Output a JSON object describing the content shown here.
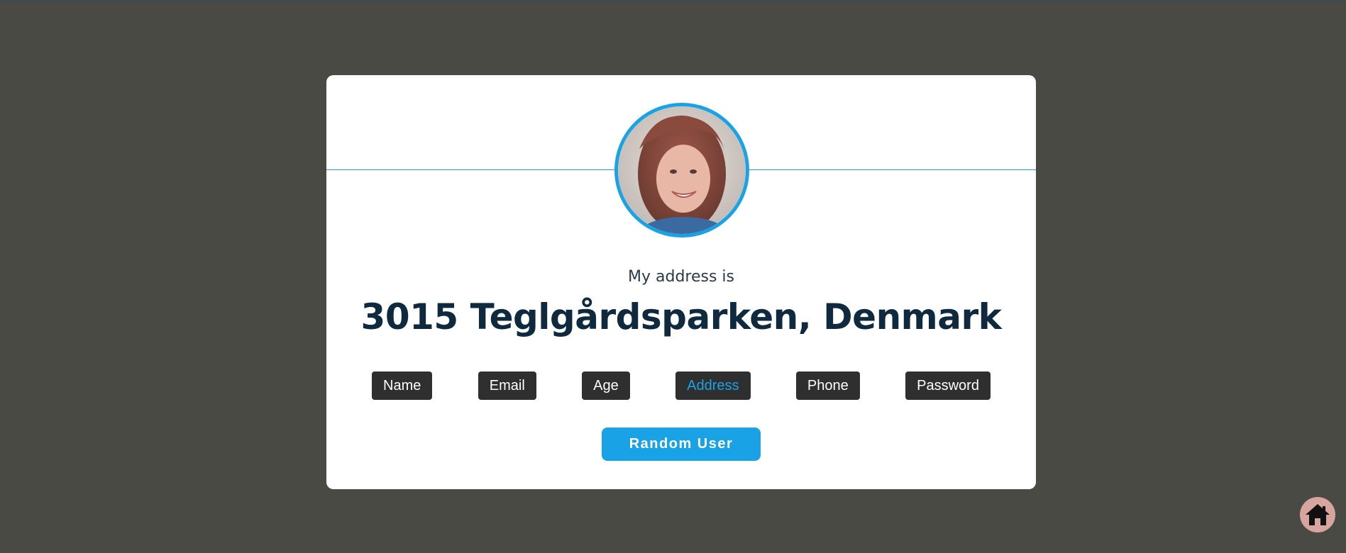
{
  "profile": {
    "label": "My address is",
    "value": "3015 Teglgårdsparken, Denmark",
    "avatar_alt": "user-photo"
  },
  "tabs": [
    {
      "label": "Name",
      "active": false
    },
    {
      "label": "Email",
      "active": false
    },
    {
      "label": "Age",
      "active": false
    },
    {
      "label": "Address",
      "active": true
    },
    {
      "label": "Phone",
      "active": false
    },
    {
      "label": "Password",
      "active": false
    }
  ],
  "actions": {
    "random_user_label": "Random User"
  },
  "icons": {
    "home": "home-icon"
  },
  "colors": {
    "background": "#4a4a45",
    "accent": "#19a3e6",
    "tab_bg": "#2f2f2f",
    "title": "#0f2a3f",
    "home_button": "#d8a59e"
  }
}
